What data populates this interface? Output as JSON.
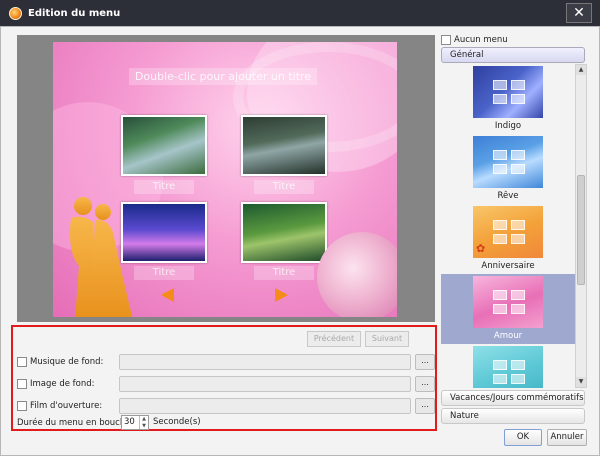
{
  "window": {
    "title": "Edition du menu",
    "close_glyph": "✕"
  },
  "preview": {
    "menu_title": "Double-clic pour ajouter un titre",
    "chapter_captions": [
      "Titre",
      "Titre",
      "Titre",
      "Titre"
    ]
  },
  "nav": {
    "prev_label": "Précédent",
    "next_label": "Suivant"
  },
  "settings": {
    "music_label": "Musique de fond:",
    "image_label": "Image de fond:",
    "opening_label": "Film d'ouverture:",
    "browse_label": "...",
    "loop_label": "Durée du menu en boucle:",
    "loop_value": "30",
    "seconds_label": "Seconde(s)"
  },
  "themes": {
    "none_label": "Aucun menu",
    "groups": [
      "Général",
      "Vacances/Jours commémoratifs",
      "Nature"
    ],
    "items": [
      {
        "name": "Indigo",
        "color": "#4a63c9"
      },
      {
        "name": "Rêve",
        "color": "#5aa0e6"
      },
      {
        "name": "Anniversaire",
        "color": "#f4a23a"
      },
      {
        "name": "Amour",
        "color": "#e86fb6"
      },
      {
        "name": "",
        "color": "#5fc9d6"
      }
    ],
    "selected": "Amour"
  },
  "footer": {
    "ok_label": "OK",
    "cancel_label": "Annuler"
  }
}
